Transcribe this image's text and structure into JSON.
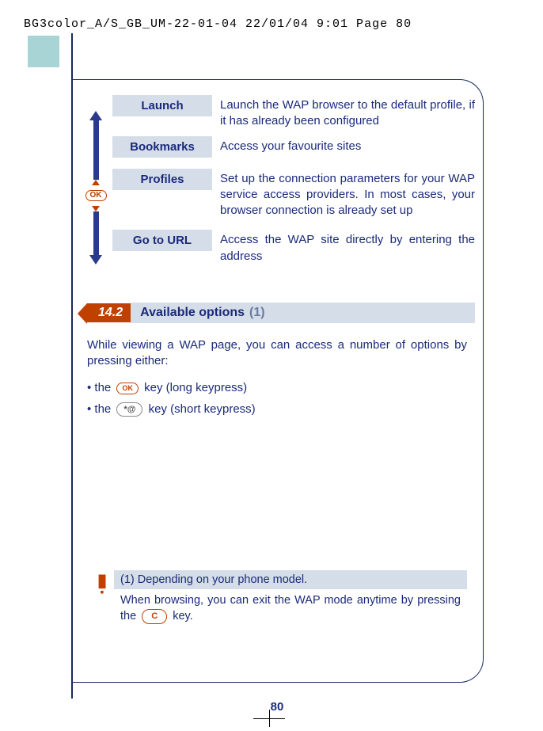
{
  "header": "BG3color_A/S_GB_UM-22-01-04  22/01/04  9:01  Page 80",
  "ok_label": "OK",
  "menu": {
    "items": [
      {
        "label": "Launch",
        "desc": "Launch the WAP browser to the default profile, if it has already been configured"
      },
      {
        "label": "Bookmarks",
        "desc": "Access your favourite sites"
      },
      {
        "label": "Profiles",
        "desc": "Set up the connection parameters for your WAP service access providers. In most cases, your browser connection is already set up"
      },
      {
        "label": "Go to URL",
        "desc": "Access the WAP site directly by entering the address"
      }
    ]
  },
  "section": {
    "number": "14.2",
    "title": "Available options",
    "sub": "(1)"
  },
  "intro": "While viewing a WAP page, you can access a number of options by pressing either:",
  "bullets": {
    "prefix1": "• the",
    "suffix1": "key (long keypress)",
    "prefix2": "• the",
    "star_key": "*@",
    "suffix2": "key (short keypress)"
  },
  "footnote": {
    "line1": "(1)  Depending on your phone model.",
    "line2a": "When browsing, you can exit the WAP mode anytime by pressing the",
    "c_key": "C",
    "line2b": "key."
  },
  "page_number": "80"
}
